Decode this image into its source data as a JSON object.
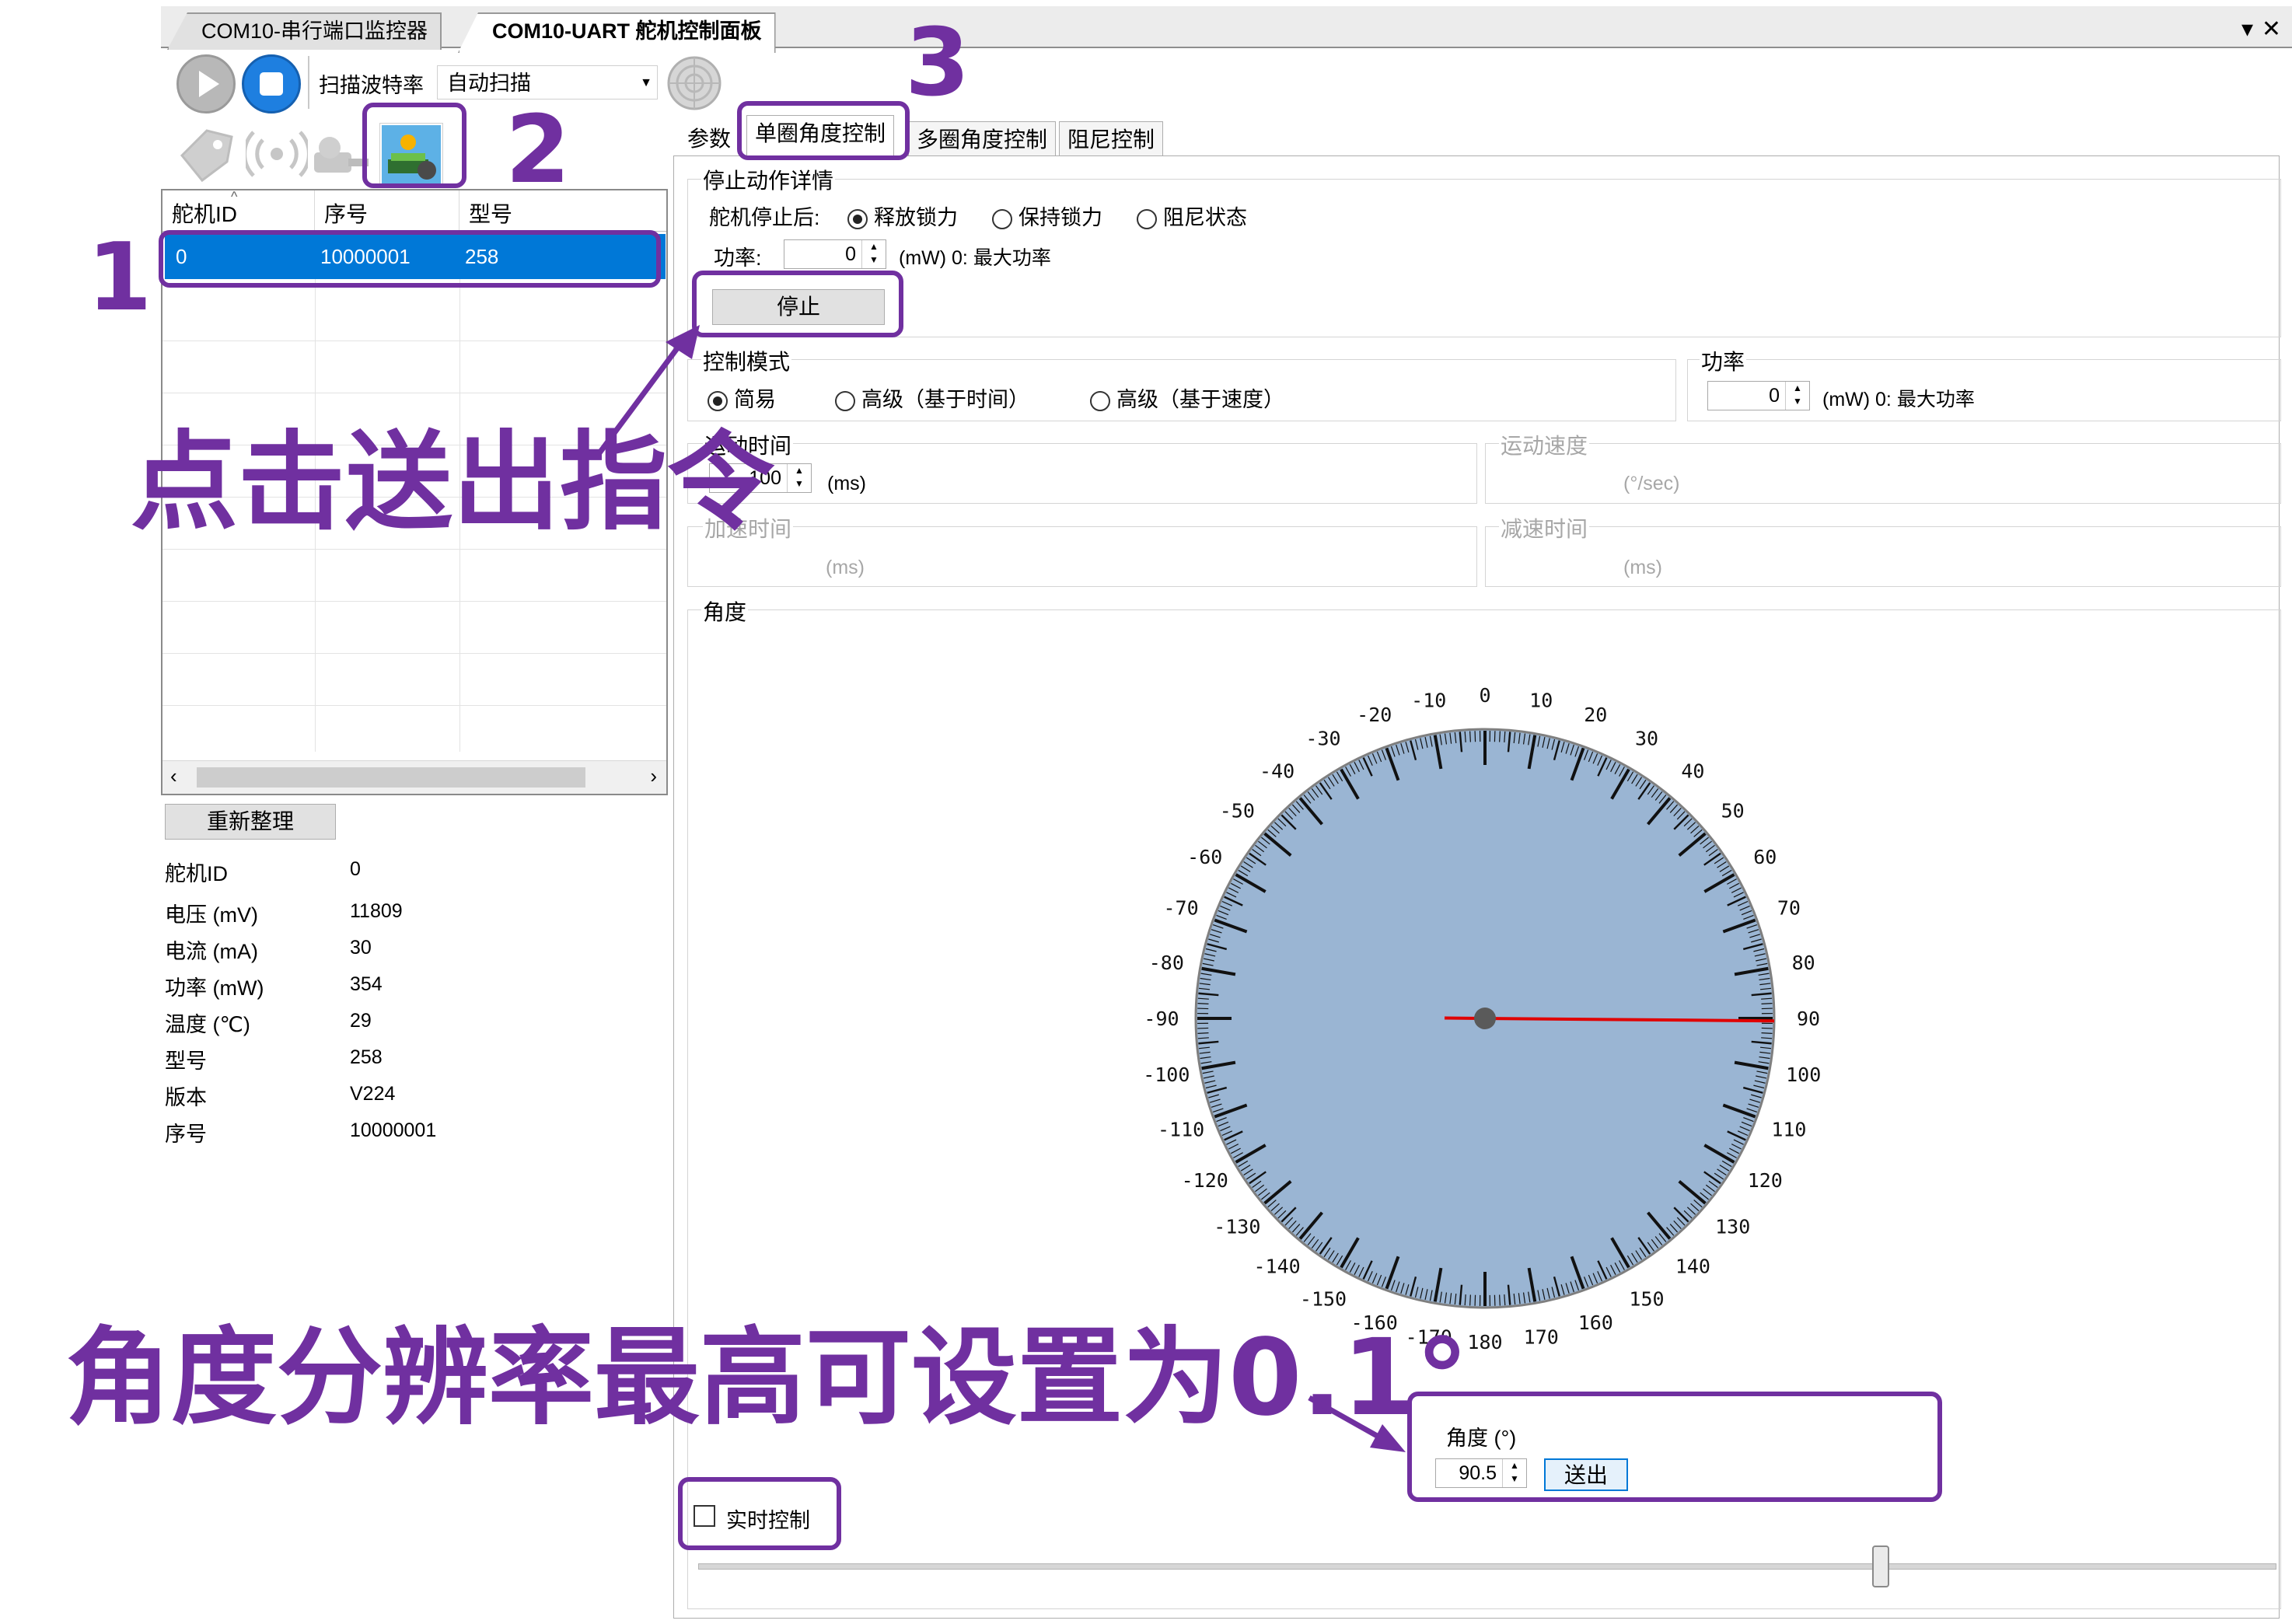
{
  "tabs": {
    "monitor": "COM10-串行端口监控器",
    "control": "COM10-UART 舵机控制面板",
    "dropdown_icon": "▾",
    "close_icon": "✕"
  },
  "toolbar": {
    "baud_label": "扫描波特率",
    "baud_value": "自动扫描"
  },
  "servo_grid": {
    "columns": [
      "舵机ID",
      "序号",
      "型号"
    ],
    "rows": [
      [
        "0",
        "10000001",
        "258"
      ]
    ]
  },
  "reorganize_label": "重新整理",
  "info": [
    {
      "label": "舵机ID",
      "value": "0"
    },
    {
      "label": "电压 (mV)",
      "value": "11809"
    },
    {
      "label": "电流 (mA)",
      "value": "30"
    },
    {
      "label": "功率 (mW)",
      "value": "354"
    },
    {
      "label": "温度 (℃)",
      "value": "29"
    },
    {
      "label": "型号",
      "value": "258"
    },
    {
      "label": "版本",
      "value": "V224"
    },
    {
      "label": "序号",
      "value": "10000001"
    }
  ],
  "panel_tabs": [
    "参数",
    "单圈角度控制",
    "多圈角度控制",
    "阻尼控制"
  ],
  "stop_group": {
    "title": "停止动作详情",
    "after_label": "舵机停止后:",
    "options": [
      "释放锁力",
      "保持锁力",
      "阻尼状态"
    ],
    "selected": 0,
    "power_label": "功率:",
    "power_value": "0",
    "power_hint": "(mW) 0: 最大功率",
    "stop_button": "停止"
  },
  "mode_group": {
    "title": "控制模式",
    "options": [
      "简易",
      "高级（基于时间）",
      "高级（基于速度）"
    ],
    "selected": 0
  },
  "power_group": {
    "title": "功率",
    "value": "0",
    "hint": "(mW) 0: 最大功率"
  },
  "move_time": {
    "title": "运动时间",
    "value": "100",
    "unit": "(ms)"
  },
  "move_speed": {
    "title": "运动速度",
    "unit": "(°/sec)"
  },
  "accel_time": {
    "title": "加速时间",
    "unit": "(ms)"
  },
  "decel_time": {
    "title": "减速时间",
    "unit": "(ms)"
  },
  "angle_group": {
    "title": "角度"
  },
  "dial": {
    "labels": [
      "0",
      "10",
      "20",
      "30",
      "40",
      "50",
      "60",
      "70",
      "80",
      "90",
      "100",
      "110",
      "120",
      "130",
      "140",
      "150",
      "160",
      "170",
      "180",
      "-170",
      "-160",
      "-150",
      "-140",
      "-130",
      "-120",
      "-110",
      "-100",
      "-90",
      "-80",
      "-70",
      "-60",
      "-50",
      "-40",
      "-30",
      "-20",
      "-10"
    ],
    "needle_angle": 90.5,
    "face_color": "#9ab5d3",
    "needle_color": "#e00000"
  },
  "angle_input": {
    "label": "角度 (°)",
    "value": "90.5",
    "send_button": "送出"
  },
  "realtime": {
    "label": "实时控制",
    "checked": false
  },
  "slider": {
    "value_fraction": 0.75
  },
  "annotations": {
    "n1": "1",
    "n2": "2",
    "n3": "3",
    "click_send": "点击送出指令",
    "resolution": "角度分辨率最高可设置为0.1°"
  },
  "colors": {
    "annotation": "#7030a0",
    "selection": "#0078d7"
  }
}
